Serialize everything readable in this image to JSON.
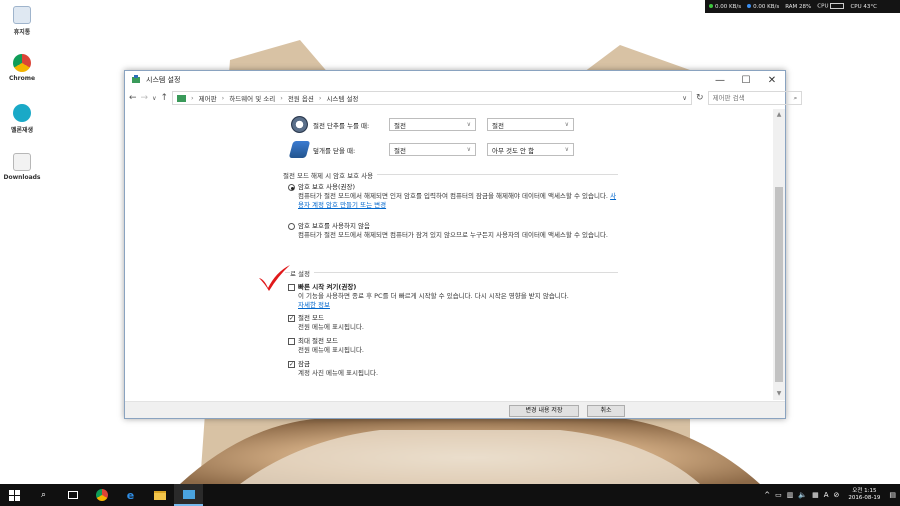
{
  "desktop": {
    "icons": [
      {
        "label": "휴지통"
      },
      {
        "label": "Chrome"
      },
      {
        "label": "멜론재생"
      },
      {
        "label": "Downloads"
      }
    ]
  },
  "perf": {
    "upload": "0.00 KB/s",
    "download": "0.00 KB/s",
    "ram": "RAM 28%",
    "cpu_label": "CPU",
    "cpu_temp": "CPU 43°C"
  },
  "window": {
    "title": "시스템 설정",
    "controls": {
      "minimize": "—",
      "maximize": "☐",
      "close": "✕"
    },
    "breadcrumb": [
      "제어판",
      "하드웨어 및 소리",
      "전원 옵션",
      "시스템 설정"
    ],
    "search_placeholder": "제어판 검색",
    "power_rows": [
      {
        "label": "절전 단추를 누를 때:",
        "battery": "절전",
        "plugged": "절전"
      },
      {
        "label": "덮개를 닫을 때:",
        "battery": "절전",
        "plugged": "아무 것도 안 함"
      }
    ],
    "password_group": {
      "title": "절전 모드 해제 시 암호 보호 사용",
      "options": [
        {
          "label": "암호 보호 사용(권장)",
          "checked": true,
          "desc": "컴퓨터가 절전 모드에서 해제되면 인저 암호를 입력하여 컴퓨터의 잠금을 해제해야 데이터에 액세스할 수 있습니다.",
          "link": "사용자 계정 암호 만들기 또는 변경"
        },
        {
          "label": "암호 보호를 사용하지 않음",
          "checked": false,
          "desc": "컴퓨터가 절전 모드에서 해제되면 컴퓨터가 잠겨 있지 않으므로 누구든지 사용자의 데이터에 액세스할 수 있습니다."
        }
      ]
    },
    "shutdown_group": {
      "title": "료 설정",
      "options": [
        {
          "label": "빠른 시작 켜기(권장)",
          "checked": false,
          "desc": "이 기능을 사용하면 종료 후 PC를 더 빠르게 시작할 수 있습니다. 다시 시작은 영향을 받지 않습니다.",
          "link": "자세한 정보"
        },
        {
          "label": "절전 모드",
          "checked": true,
          "desc": "전원 메뉴에 표시됩니다."
        },
        {
          "label": "최대 절전 모드",
          "checked": false,
          "desc": "전원 메뉴에 표시됩니다."
        },
        {
          "label": "잠금",
          "checked": true,
          "desc": "계정 사진 메뉴에 표시됩니다."
        }
      ]
    },
    "buttons": {
      "save": "변경 내용 저장",
      "cancel": "취소"
    }
  },
  "taskbar": {
    "clock_time": "오전 1:15",
    "clock_date": "2016-08-19",
    "tray_arrow": "^"
  },
  "colors": {
    "accent": "#0066cc",
    "checkmark": "#e0191b",
    "taskbar": "#101010"
  }
}
